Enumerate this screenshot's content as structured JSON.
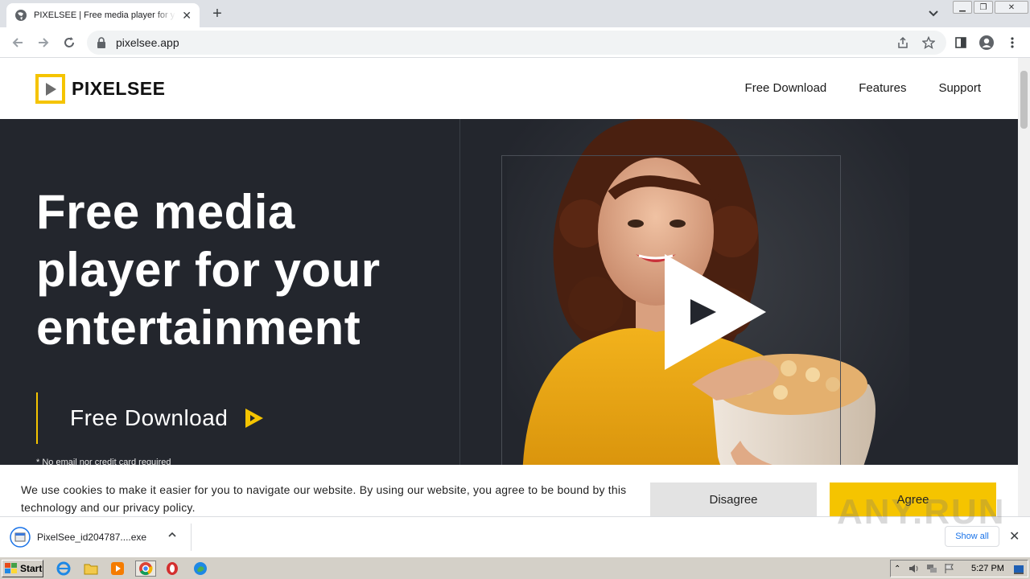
{
  "browser": {
    "tab_title": "PIXELSEE | Free media player for your entertainment",
    "url": "pixelsee.app"
  },
  "site": {
    "logo_text": "PIXELSEE",
    "nav": [
      "Free Download",
      "Features",
      "Support"
    ],
    "hero_title_lines": [
      "Free media",
      "player for your",
      "entertainment"
    ],
    "cta_label": "Free Download",
    "note": "* No email nor credit card required"
  },
  "cookie": {
    "text": "We use cookies to make it easier for you to navigate our website. By using our website, you agree to be bound by this technology and our privacy policy.",
    "disagree": "Disagree",
    "agree": "Agree"
  },
  "downloads": {
    "file_name": "PixelSee_id204787....exe",
    "show_all": "Show all"
  },
  "taskbar": {
    "start_label": "Start",
    "clock": "5:27 PM"
  },
  "watermark": "ANY.RUN",
  "colors": {
    "brand_yellow": "#f5c400",
    "hero_bg": "#23262d"
  }
}
